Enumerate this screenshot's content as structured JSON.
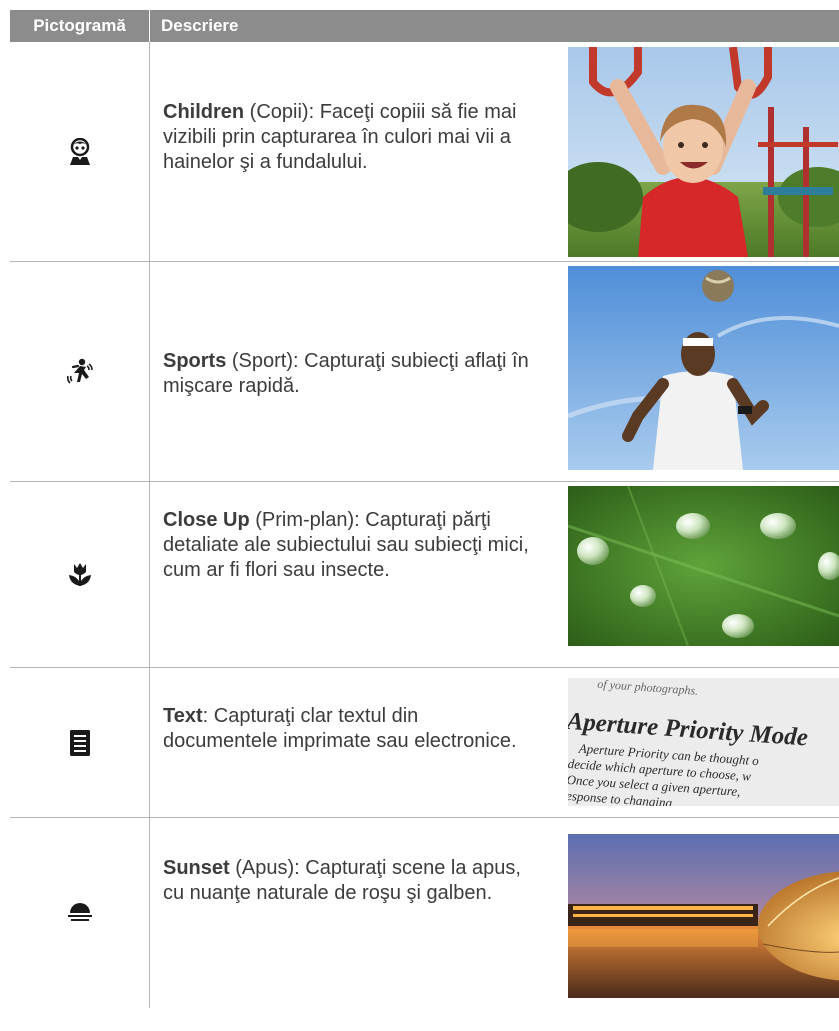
{
  "header": {
    "col_icon": "Pictogramă",
    "col_desc": "Descriere"
  },
  "rows": [
    {
      "icon": "children-icon",
      "title": "Children",
      "rest": " (Copii): Faceţi copiii să fie mai vizibili prin capturarea în culori mai vii a hainelor şi a fundalului."
    },
    {
      "icon": "sports-icon",
      "title": "Sports",
      "rest": " (Sport): Capturaţi subiecţi aflaţi în mişcare rapidă."
    },
    {
      "icon": "close-up-flower-icon",
      "title": "Close Up",
      "rest": " (Prim-plan): Capturaţi părţi detaliate ale subiectului sau subiecţi mici, cum ar fi flori sau insecte."
    },
    {
      "icon": "text-document-icon",
      "title": "Text",
      "rest": ": Capturaţi clar textul din documentele imprimate sau electronice."
    },
    {
      "icon": "sunset-icon",
      "title": "Sunset",
      "rest": " (Apus): Capturaţi scene la apus, cu nuanţe naturale de roşu şi galben."
    }
  ],
  "text_photo": {
    "line1": "of your photographs.",
    "heading": "Aperture Priority Mode",
    "l1": "Aperture Priority can be thought o",
    "l2": "decide which aperture to choose, w",
    "l3": "Once you select a given aperture,",
    "l4": "response to changing"
  },
  "colors": {
    "header_bg": "#8c8c8c",
    "rule": "#b4b4b4",
    "text": "#3c3c3c"
  }
}
